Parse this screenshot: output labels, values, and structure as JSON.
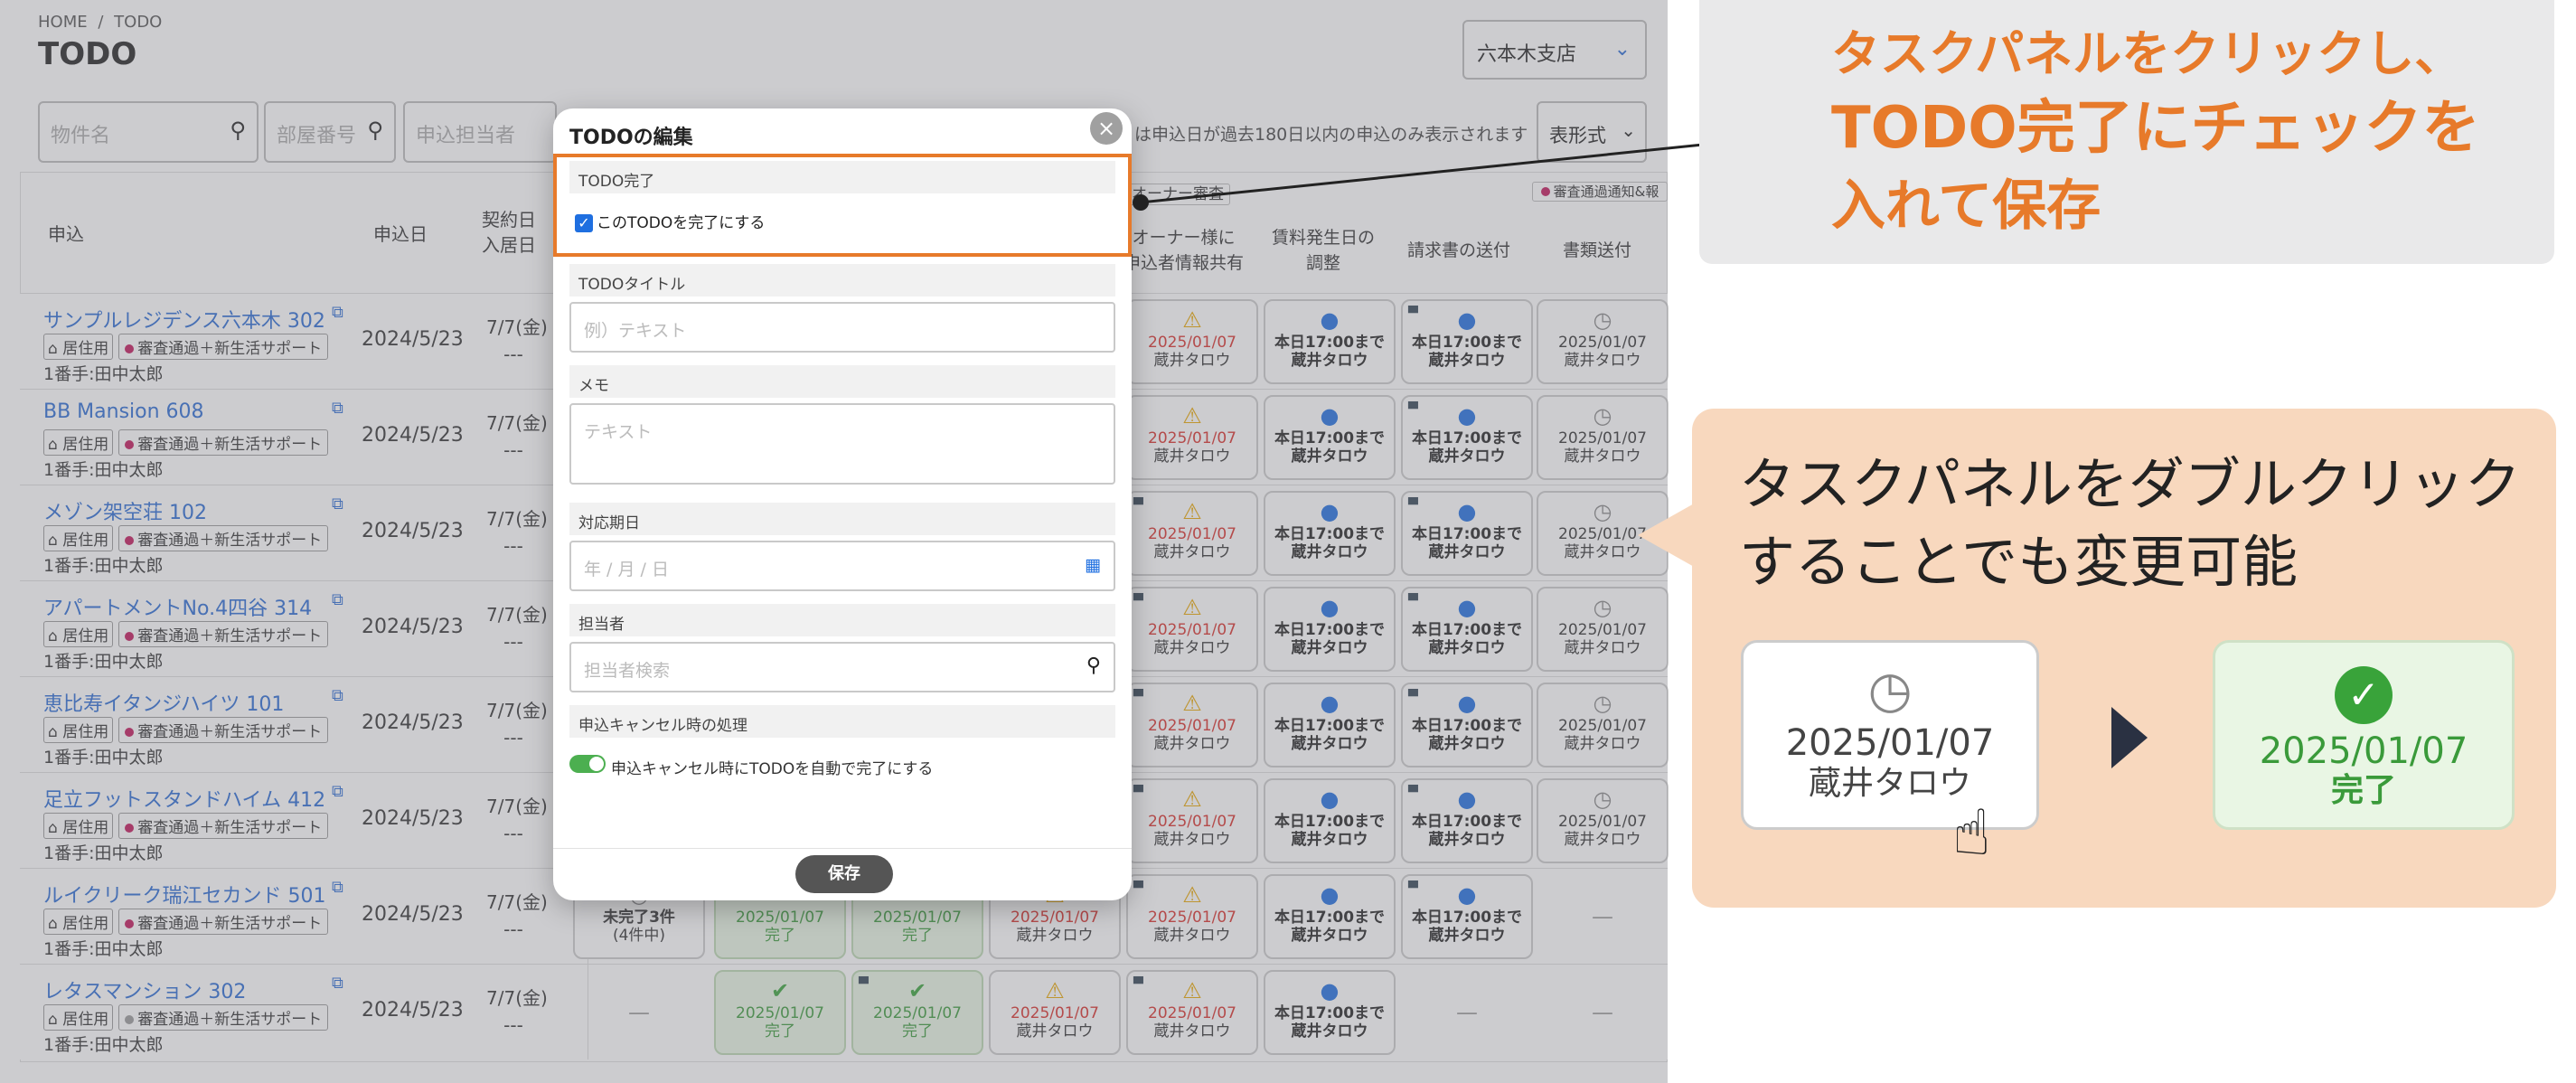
{
  "breadcrumb": {
    "home": "HOME",
    "sep": "/",
    "current": "TODO"
  },
  "title": "TODO",
  "branch": "六本木支店",
  "filters": {
    "property": "物件名",
    "room": "部屋番号",
    "staff": "申込担当者"
  },
  "filter_note": "は申込日が過去180日以内の申込のみ表示されます",
  "view_select": "表形式",
  "columns": {
    "application": "申込",
    "date": "申込日",
    "contract": "契約日\n入居日",
    "owner": "オーナー様に\n申込者情報共有",
    "rent": "賃料発生日の\n調整",
    "invoice": "請求書の送付",
    "docs": "書類送付",
    "owner_tag": "オーナー審査",
    "review_tag": "審査通過通知&報"
  },
  "rows": [
    {
      "name": "サンプルレジデンス六本木 302",
      "kind": "居住用",
      "plan": "審査通過＋新生活サポート",
      "person": "1番手:田中太郎",
      "date": "2024/5/23",
      "contract": "7/7(金)",
      "contract2": "---"
    },
    {
      "name": "BB Mansion 608",
      "kind": "居住用",
      "plan": "審査通過＋新生活サポート",
      "person": "1番手:田中太郎",
      "date": "2024/5/23",
      "contract": "7/7(金)",
      "contract2": "---"
    },
    {
      "name": "メゾン架空荘 102",
      "kind": "居住用",
      "plan": "審査通過＋新生活サポート",
      "person": "1番手:田中太郎",
      "date": "2024/5/23",
      "contract": "7/7(金)",
      "contract2": "---"
    },
    {
      "name": "アパートメントNo.4四谷 314",
      "kind": "居住用",
      "plan": "審査通過＋新生活サポート",
      "person": "1番手:田中太郎",
      "date": "2024/5/23",
      "contract": "7/7(金)",
      "contract2": "---"
    },
    {
      "name": "恵比寿イタンジハイツ 101",
      "kind": "居住用",
      "plan": "審査通過＋新生活サポート",
      "person": "1番手:田中太郎",
      "date": "2024/5/23",
      "contract": "7/7(金)",
      "contract2": "---"
    },
    {
      "name": "足立フットスタンドハイム 412",
      "kind": "居住用",
      "plan": "審査通過＋新生活サポート",
      "person": "1番手:田中太郎",
      "date": "2024/5/23",
      "contract": "7/7(金)",
      "contract2": "---"
    },
    {
      "name": "ルイクリーク瑞江セカンド 501",
      "kind": "居住用",
      "plan": "審査通過＋新生活サポート",
      "person": "1番手:田中太郎",
      "date": "2024/5/23",
      "contract": "7/7(金)",
      "contract2": "---"
    },
    {
      "name": "レタスマンション 302",
      "kind": "居住用",
      "plan": "審査通過＋新生活サポート",
      "person": "1番手:田中太郎",
      "date": "2024/5/23",
      "contract": "7/7(金)",
      "contract2": "---"
    }
  ],
  "task_texts": {
    "warn_date": "2025/01/07",
    "warn_name": "蔵井タロウ",
    "info_1": "本日17:00まで",
    "info_2": "蔵井タロウ",
    "pend_date": "2025/01/07",
    "pend_name": "蔵井タロウ",
    "done_date": "2025/01/07",
    "done_label": "完了",
    "incomplete": "未完了3件",
    "incomplete_sub": "(4件中)",
    "dash": "—"
  },
  "modal": {
    "title": "TODOの編集",
    "sec_done": "TODO完了",
    "checkbox": "このTODOを完了にする",
    "sec_title": "TODOタイトル",
    "title_placeholder": "例）テキスト",
    "sec_memo": "メモ",
    "memo_placeholder": "テキスト",
    "sec_due": "対応期日",
    "due_placeholder": "年 / 月 / 日",
    "sec_assignee": "担当者",
    "assignee_placeholder": "担当者検索",
    "sec_cancel": "申込キャンセル時の処理",
    "toggle_label": "申込キャンセル時にTODOを自動で完了にする",
    "save": "保存"
  },
  "callout1": {
    "l1": "タスクパネルをクリックし、",
    "l2": "TODO完了にチェックを",
    "l3": "入れて保存"
  },
  "callout2": {
    "l1": "タスクパネルをダブルクリック",
    "l2": "することでも変更可能",
    "before_date": "2025/01/07",
    "before_name": "蔵井タロウ",
    "after_date": "2025/01/07",
    "after_label": "完了"
  },
  "colors": {
    "accent": "#e77a2a",
    "link": "#2a6bd3",
    "done": "#39a33a",
    "warn": "#d9302a"
  }
}
